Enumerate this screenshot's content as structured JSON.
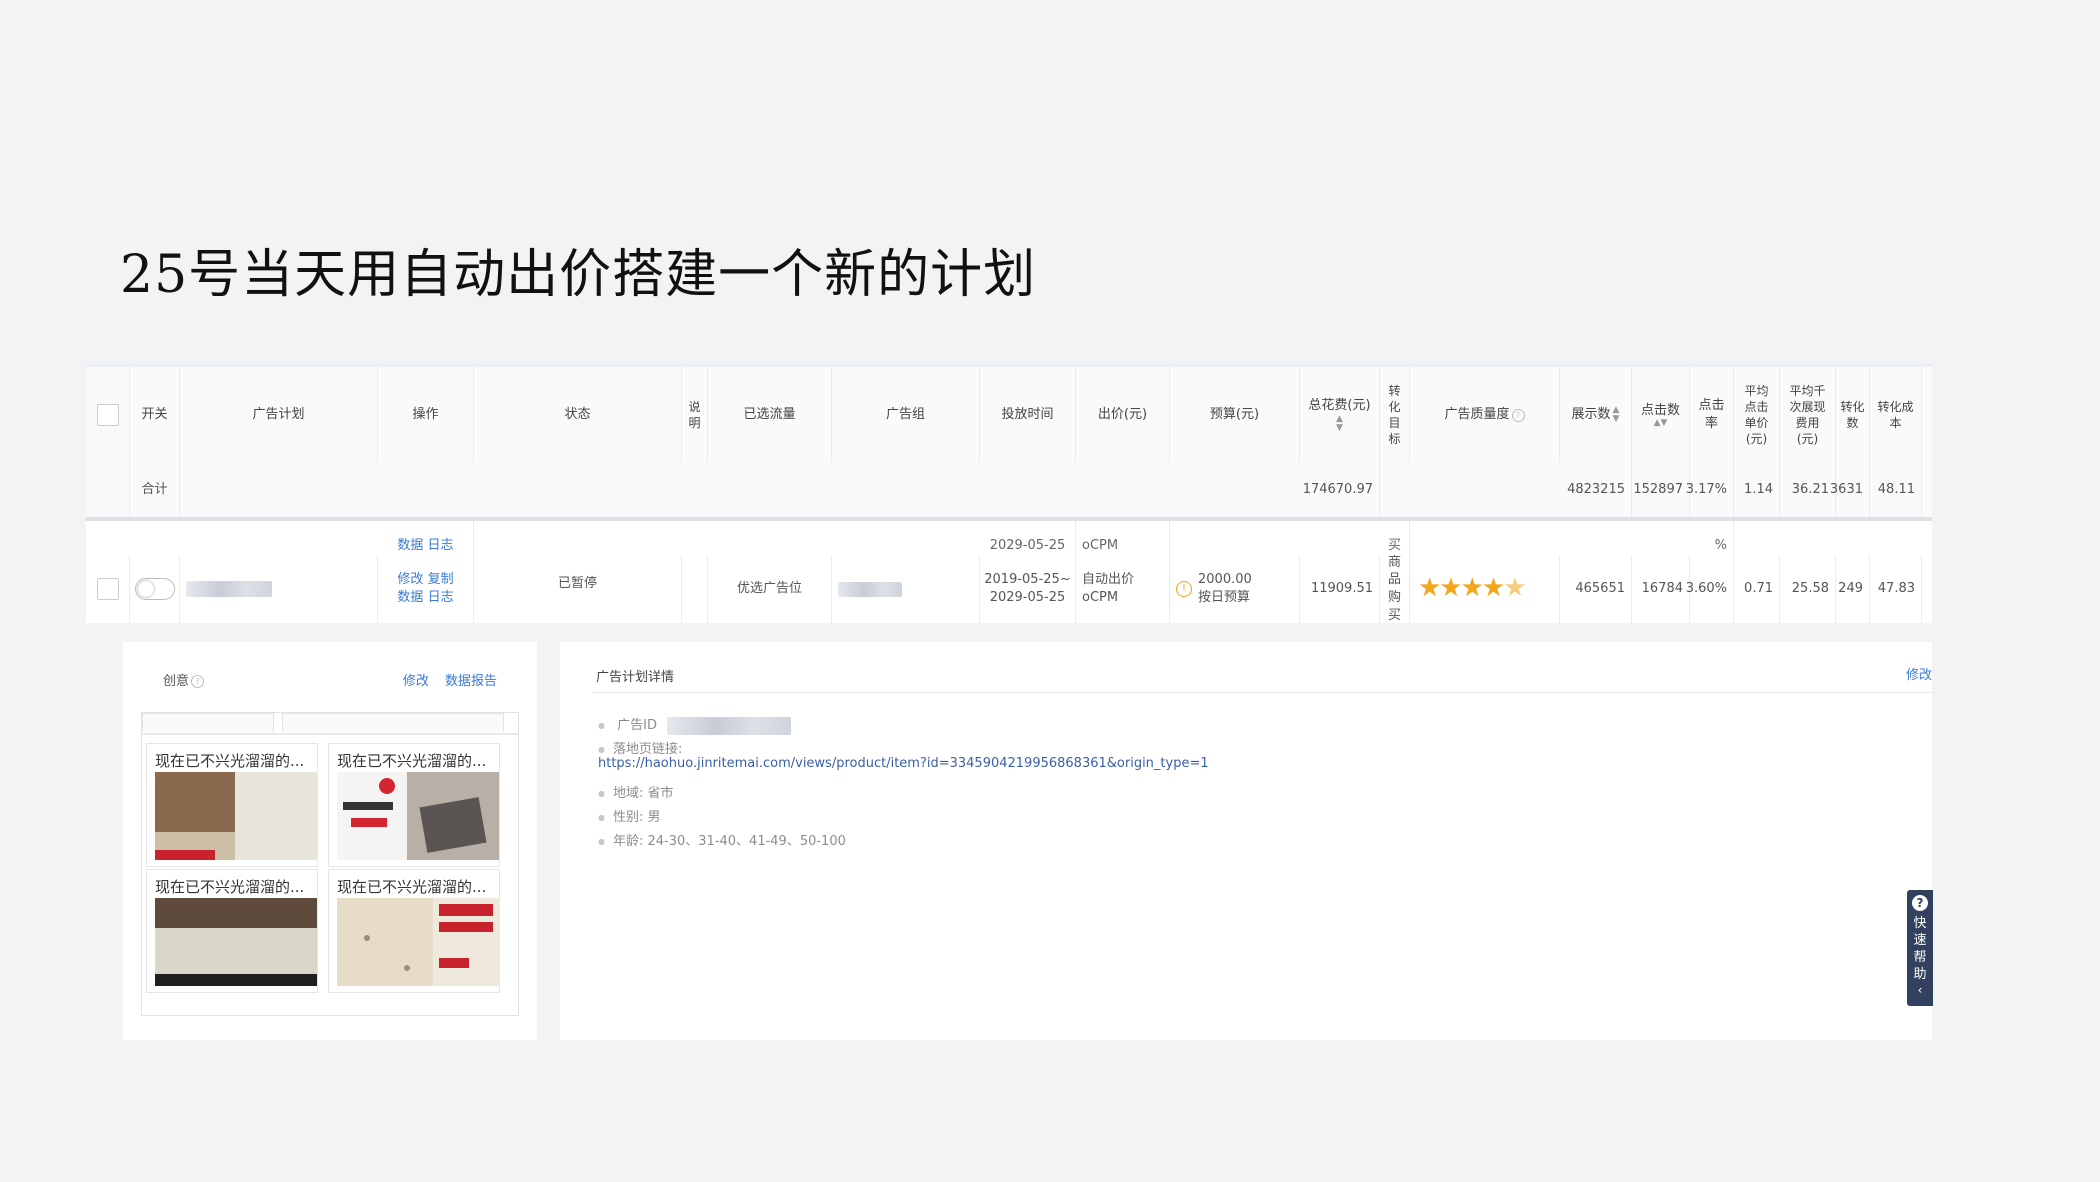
{
  "slide_title": "25号当天用自动出价搭建一个新的计划",
  "table": {
    "headers": {
      "switch": "开关",
      "plan": "广告计划",
      "action": "操作",
      "status": "状态",
      "note": "说明",
      "traffic": "已选流量",
      "group": "广告组",
      "time": "投放时间",
      "bid": "出价(元)",
      "budget": "预算(元)",
      "cost": "总花费(元)",
      "target": "转化目标",
      "quality": "广告质量度",
      "impressions": "展示数",
      "clicks": "点击数",
      "ctr": "点击率",
      "cpc": "平均点击单价(元)",
      "cpm": "平均千次展现费用(元)",
      "conversions": "转化数",
      "cpa": "转化成本"
    },
    "total": {
      "label": "合计",
      "cost": "174670.97",
      "impressions": "4823215",
      "clicks": "152897",
      "ctr": "3.17%",
      "cpc": "1.14",
      "cpm": "36.21",
      "conversions": "3631",
      "cpa": "48.11"
    },
    "ghost_row": {
      "action": "数据 日志",
      "time": "2029-05-25",
      "bid": "oCPM",
      "ctr": "%",
      "target": "买"
    },
    "row": {
      "action_edit": "修改",
      "action_copy": "复制",
      "action_data": "数据",
      "action_log": "日志",
      "status": "已暂停",
      "traffic": "优选广告位",
      "time_start": "2019-05-25~",
      "time_end": "2029-05-25",
      "bid_type": "自动出价",
      "bid_mode": "oCPM",
      "budget_amount": "2000.00",
      "budget_type": "按日预算",
      "cost": "11909.51",
      "target": "商品购买",
      "quality_stars": 4.5,
      "impressions": "465651",
      "clicks": "16784",
      "ctr": "3.60%",
      "cpc": "0.71",
      "cpm": "25.58",
      "conversions": "249",
      "cpa": "47.83"
    }
  },
  "creative": {
    "title": "创意",
    "edit": "修改",
    "report": "数据报告",
    "thumbs": [
      {
        "caption": "现在已不兴光溜溜的..."
      },
      {
        "caption": "现在已不兴光溜溜的..."
      },
      {
        "caption": "现在已不兴光溜溜的..."
      },
      {
        "caption": "现在已不兴光溜溜的..."
      }
    ]
  },
  "detail": {
    "title": "广告计划详情",
    "edit": "修改",
    "ad_id_label": "广告ID",
    "landing_label": "落地页链接:",
    "landing_url": "https://haohuo.jinritemai.com/views/product/item?id=3345904219956868361&origin_type=1",
    "region": "地域: 省市",
    "gender": "性别: 男",
    "age": "年龄: 24-30、31-40、41-49、50-100"
  },
  "help": {
    "label": "快速帮助"
  }
}
